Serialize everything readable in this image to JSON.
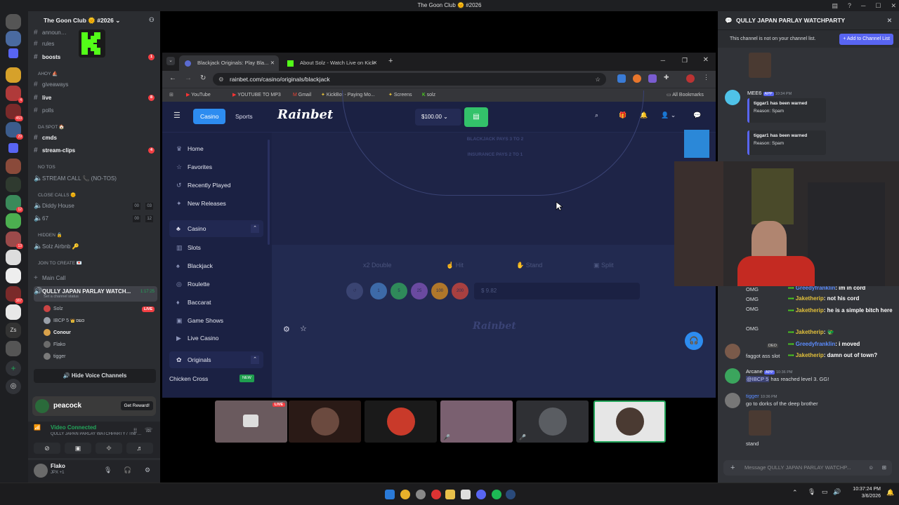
{
  "window": {
    "title": "The Goon Club 🌞 #2026"
  },
  "server": {
    "name": "The Goon Club 🌞 #2026"
  },
  "rail_badges": [
    "4",
    "453",
    "29",
    "12",
    "13",
    "167"
  ],
  "channels": {
    "top": [
      {
        "name": "announ…",
        "bold": false
      },
      {
        "name": "rules",
        "bold": false
      },
      {
        "name": "boosts",
        "bold": true,
        "badge": "1"
      }
    ],
    "cat_ahoy": "AHOY ⛵",
    "ahoy": [
      {
        "name": "giveaways",
        "bold": false
      },
      {
        "name": "live",
        "bold": true,
        "badge": "8"
      },
      {
        "name": "polls",
        "bold": false
      }
    ],
    "cat_daspot": "DA SPOT 🏠",
    "daspot": [
      {
        "name": "cmds",
        "bold": true
      },
      {
        "name": "stream-clips",
        "bold": true,
        "badge": "4"
      }
    ],
    "cat_notos": "NO TOS",
    "stream_call": "STREAM CALL 📞 (NO-TOS)",
    "cat_close": "CLOSE CALLS 🌞",
    "diddy": {
      "name": "Diddy House",
      "a": "00",
      "b": "03"
    },
    "sixseven": {
      "name": "67",
      "a": "00",
      "b": "12"
    },
    "cat_hidden": "HIDDEN 🔒",
    "solz": "Solz Airbnb 🔑",
    "cat_join": "JOIN TO CREATE 💌",
    "main_call": "Main Call",
    "active_voice": {
      "name": "QULLY JAPAN PARLAY WATCH...",
      "time": "1:17:25",
      "status": "Set a channel status"
    },
    "voice_users": [
      {
        "name": "Solz",
        "tag": "LIVE",
        "color": "#f23f43"
      },
      {
        "name": "IBCP 5",
        "tag": "👑 DEO",
        "color": "#9aa0aa"
      },
      {
        "name": "Conour",
        "tag": "",
        "color": "#d9a24b"
      },
      {
        "name": "Flako",
        "tag": "",
        "color": "#6b6b6b"
      },
      {
        "name": "tigger",
        "tag": "",
        "color": "#7a7a7a"
      }
    ],
    "hide_voice": "Hide Voice Channels"
  },
  "promo": {
    "brand": "peacock",
    "cta": "Get Reward!"
  },
  "voice_status": {
    "title": "Video Connected",
    "sub": "QULLY JAPAN PARLAY WATCHPARTY / The Goon..."
  },
  "user": {
    "name": "Flako",
    "status": "JPX +1"
  },
  "browser": {
    "tabs": [
      "Blackjack Originals: Play Bla...",
      "About Solz - Watch Live on Kick"
    ],
    "url": "rainbet.com/casino/originals/blackjack",
    "bookmarks": [
      "YouTube",
      "YOUTUBE TO MP3",
      "Gmail",
      "KickBot - Paying Mo...",
      "Screens",
      "solz"
    ],
    "all_bookmarks": "All Bookmarks"
  },
  "rainbet": {
    "casino": "Casino",
    "sports": "Sports",
    "logo": "Rainbet",
    "balance": "$100.00",
    "nav": [
      {
        "label": "Home",
        "icon": "♛"
      },
      {
        "label": "Favorites",
        "icon": "☆"
      },
      {
        "label": "Recently Played",
        "icon": "↺"
      },
      {
        "label": "New Releases",
        "icon": "✦"
      }
    ],
    "casino_section": "Casino",
    "casino_items": [
      "Slots",
      "Blackjack",
      "Roulette",
      "Baccarat",
      "Game Shows",
      "Live Casino"
    ],
    "originals_section": "Originals",
    "chicken": "Chicken Cross",
    "new_badge": "NEW",
    "table_text1": "BLACKJACK PAYS 3 TO 2",
    "table_text2": "INSURANCE PAYS 2 TO 1",
    "actions": [
      "x2 Double",
      "Hit",
      "Stand",
      "Split"
    ],
    "chips": [
      "1",
      "5",
      "25",
      "100",
      "200"
    ],
    "bet_amount": "$ 9.82",
    "watermark": "Rainbet"
  },
  "right_panel": {
    "title": "QULLY JAPAN PARLAY WATCHPARTY",
    "notice": "This channel is not on your channel list.",
    "add_button": "Add to Channel List",
    "mee6": {
      "name": "MEE6",
      "badge": "APP",
      "time": "10:34 PM"
    },
    "warnings": [
      {
        "line": "tiggar1 has been warned",
        "reason": "Reason: Spam"
      },
      {
        "line": "tiggar1 has been warned",
        "reason": "Reason: Spam"
      }
    ],
    "omg": [
      "OMG",
      "OMG",
      "OMG",
      "OMG"
    ],
    "kick_chat": [
      {
        "user": "Greedyfranklin",
        "text": ": im in cord",
        "color": "#5b8cff"
      },
      {
        "user": "Jaketherip",
        "text": ": not his cord",
        "color": "#e3c13b"
      },
      {
        "user": "Jaketherip",
        "text": ": he is a simple bitch here",
        "color": "#e3c13b"
      },
      {
        "user": "Jaketherip",
        "text": ": 🐲",
        "color": "#e3c13b"
      },
      {
        "user": "Greedyfranklin",
        "text": ": i moved",
        "color": "#5b8cff"
      },
      {
        "user": "Jaketherip",
        "text": ": damn out of town?",
        "color": "#e3c13b"
      }
    ],
    "deo_msg": "faggot ass slot",
    "deo_tag": "DEO",
    "arcane": {
      "name": "Arcane",
      "badge": "APP",
      "time": "10:36 PM",
      "mention": "@IBCP 5",
      "text": " has reached level 3. GG!"
    },
    "tigger": {
      "name": "tigger",
      "time": "10:36 PM",
      "text": "go to dorks of the deep brother"
    },
    "stand": "stand",
    "composer": "Message QULLY JAPAN PARLAY WATCHP..."
  },
  "tile_live": "LIVE",
  "clock": {
    "time": "10:37:24 PM",
    "date": "3/6/2026"
  }
}
